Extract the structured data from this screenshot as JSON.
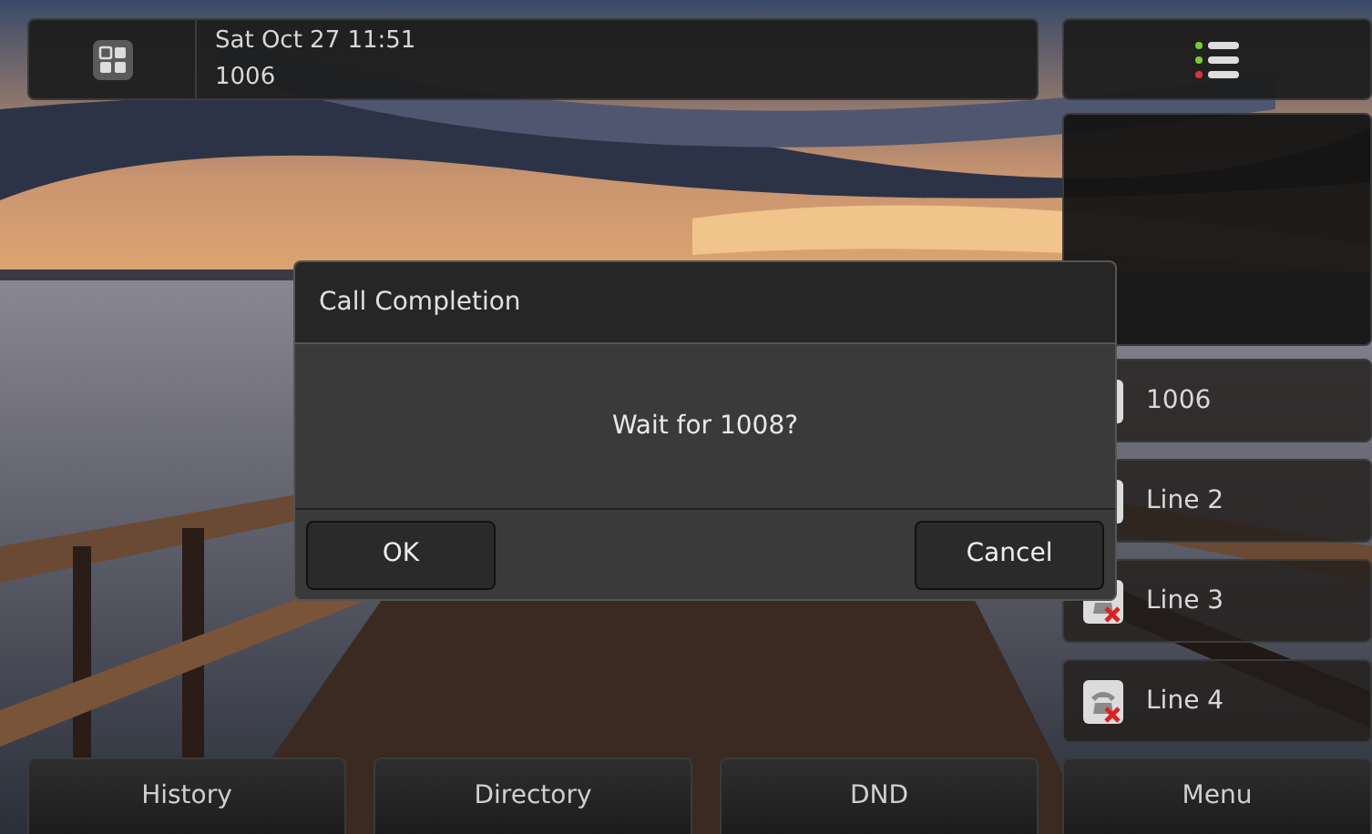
{
  "status_bar": {
    "date_time": "Sat Oct 27 11:51",
    "extension": "1006"
  },
  "line_keys": [
    {
      "label": "1006"
    },
    {
      "label": "Line 2"
    },
    {
      "label": "Line 3",
      "kind": "failed"
    },
    {
      "label": "Line 4",
      "kind": "failed"
    }
  ],
  "softkeys": [
    "History",
    "Directory",
    "DND",
    "Menu"
  ],
  "dialog": {
    "title": "Call Completion",
    "message": "Wait for 1008?",
    "buttons": [
      "OK",
      "Cancel"
    ]
  }
}
